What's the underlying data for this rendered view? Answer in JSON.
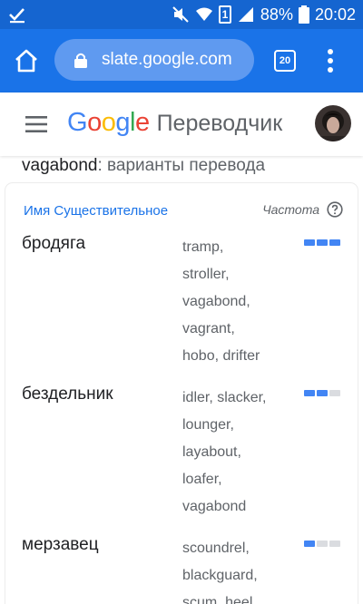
{
  "status_bar": {
    "battery_percent": "88%",
    "time": "20:02",
    "sim_slot": "1"
  },
  "browser": {
    "url": "slate.google.com",
    "tab_count": "20"
  },
  "header": {
    "logo_text": "Google",
    "product_name": "Переводчик"
  },
  "translations": {
    "source_word": "vagabond",
    "heading_suffix": ": варианты перевода",
    "part_of_speech": "Имя Существительное",
    "frequency_label": "Частота",
    "entries": [
      {
        "word": "бродяга",
        "synonyms": [
          "tramp,",
          "stroller,",
          "vagabond,",
          "vagrant,",
          "hobo, drifter"
        ],
        "frequency": 3
      },
      {
        "word": "бездельник",
        "synonyms": [
          "idler, slacker,",
          "lounger,",
          "layabout,",
          "loafer,",
          "vagabond"
        ],
        "frequency": 2
      },
      {
        "word": "мерзавец",
        "synonyms": [
          "scoundrel,",
          "blackguard,",
          "scum, heel,"
        ],
        "frequency": 1
      }
    ]
  },
  "colors": {
    "status_bar": "#1565d0",
    "toolbar": "#1a73e8",
    "accent": "#1a73e8",
    "freq_on": "#4285f4",
    "freq_off": "#dadce0"
  }
}
